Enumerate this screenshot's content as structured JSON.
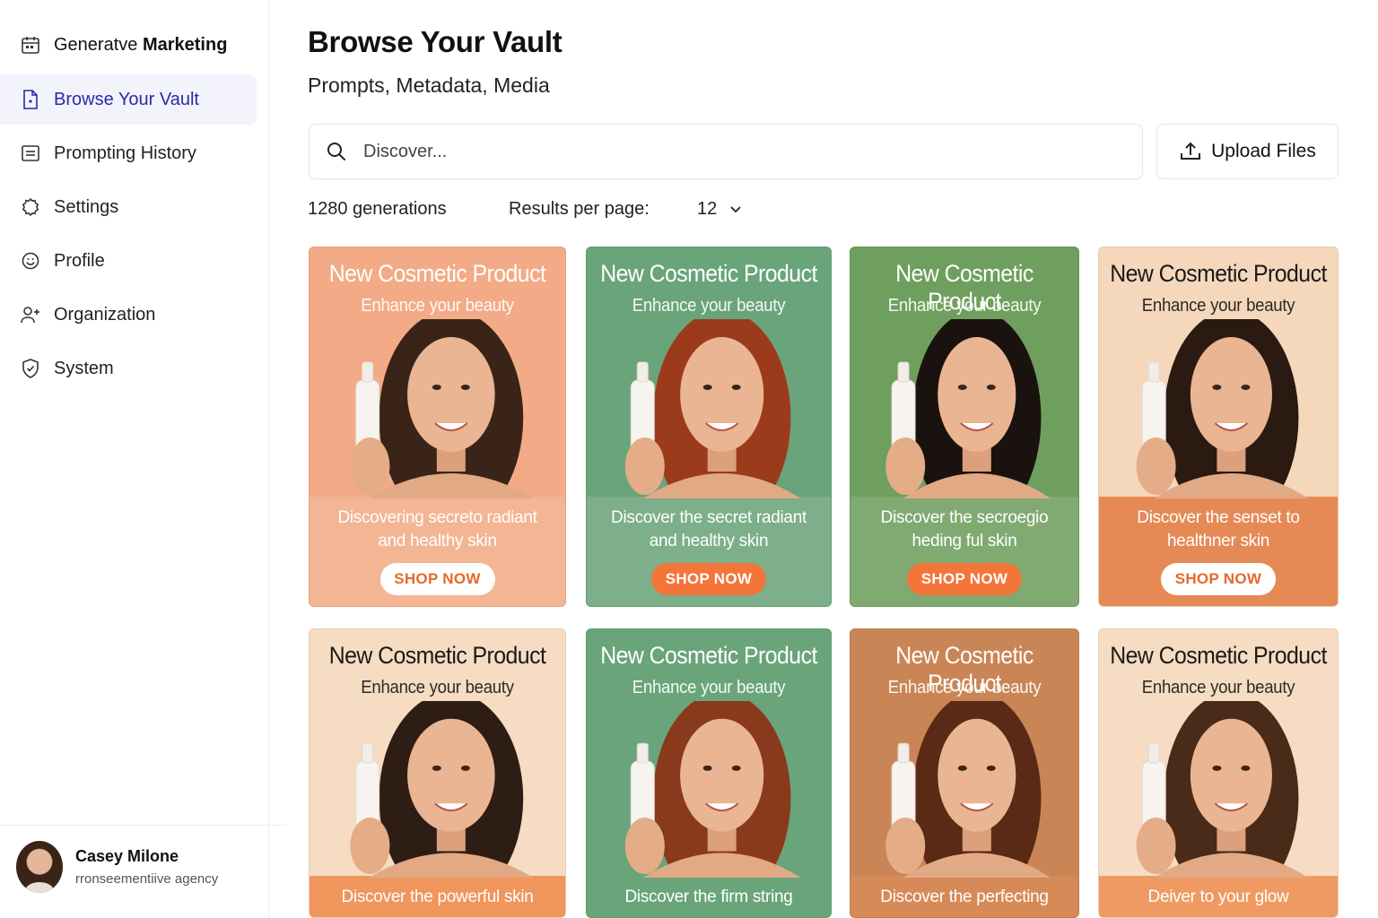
{
  "sidebar": {
    "brand": {
      "prefix": "Generatve",
      "strong": "Marketing",
      "icon": "calendar-icon"
    },
    "items": [
      {
        "label": "Browse Your Vault",
        "icon": "file-icon",
        "active": true
      },
      {
        "label": "Prompting History",
        "icon": "list-icon",
        "active": false
      },
      {
        "label": "Settings",
        "icon": "gear-icon",
        "active": false
      },
      {
        "label": "Profile",
        "icon": "smile-icon",
        "active": false
      },
      {
        "label": "Organization",
        "icon": "users-icon",
        "active": false
      },
      {
        "label": "System",
        "icon": "shield-icon",
        "active": false
      }
    ],
    "user": {
      "name": "Casey Milone",
      "org": "rronseementiive agency"
    }
  },
  "main": {
    "title": "Browse Your Vault",
    "subtitle": "Prompts, Metadata, Media",
    "search": {
      "placeholder": "Discover..."
    },
    "upload_label": "Upload Files",
    "count_label": "1280 generations",
    "results_per_page_label": "Results per page:",
    "results_per_page_value": "12"
  },
  "cards": [
    {
      "title": "New Cosmetic Product",
      "subtitle": "Enhance your beauty",
      "desc_line1": "Discovering secreto radiant",
      "desc_line2": "and healthy skin",
      "cta": "SHOP NOW",
      "bg": "#f2ab86",
      "text": "#ffffff",
      "cta_bg": "#ffffff",
      "cta_text": "#e46a2c",
      "hair": "#3a2418"
    },
    {
      "title": "New Cosmetic Product",
      "subtitle": "Enhance your beauty",
      "desc_line1": "Discover the secret radiant",
      "desc_line2": "and healthy skin",
      "cta": "SHOP NOW",
      "bg": "#6aa47a",
      "text": "#ffffff",
      "cta_bg": "#f4753a",
      "cta_text": "#ffffff",
      "hair": "#9c3b1c"
    },
    {
      "title": "New Cosmetic Product",
      "subtitle": "Enhance your beauty",
      "desc_line1": "Discover the secroegio",
      "desc_line2": "heding ful skin",
      "cta": "SHOP NOW",
      "bg": "#6f9f5e",
      "text": "#ffffff",
      "cta_bg": "#f4753a",
      "cta_text": "#ffffff",
      "hair": "#1a120e"
    },
    {
      "title": "New Cosmetic Product",
      "subtitle": "Enhance your beauty",
      "desc_line1": "Discover the senset to",
      "desc_line2": "healthner skin",
      "cta": "SHOP NOW",
      "bg": "#f5d8bc",
      "band": "#e58a55",
      "text": "#1a1a1a",
      "band_text": "#ffffff",
      "cta_bg": "#ffffff",
      "cta_text": "#e46a2c",
      "hair": "#2a1a12"
    },
    {
      "title": "New Cosmetic Product",
      "subtitle": "Enhance your beauty",
      "desc_line1": "Discover the powerful skin",
      "desc_line2": "",
      "cta": "",
      "bg": "#f6dcc2",
      "band": "#f0955c",
      "text": "#1a1a1a",
      "band_text": "#ffffff",
      "hair": "#2e1d14"
    },
    {
      "title": "New Cosmetic Product",
      "subtitle": "Enhance your beauty",
      "desc_line1": "Discover the firm string",
      "desc_line2": "",
      "cta": "",
      "bg": "#6aa47a",
      "band": "#6aa47a",
      "text": "#ffffff",
      "band_text": "#ffffff",
      "hair": "#8a3a1c"
    },
    {
      "title": "New Cosmetic Product",
      "subtitle": "Enhance your beauty",
      "desc_line1": "Discover the perfecting",
      "desc_line2": "",
      "cta": "",
      "bg": "#c98555",
      "band": "#d68a58",
      "text": "#ffffff",
      "band_text": "#ffffff",
      "hair": "#5a2a16"
    },
    {
      "title": "New Cosmetic Product",
      "subtitle": "Enhance your beauty",
      "desc_line1": "Deiver to your glow",
      "desc_line2": "",
      "cta": "",
      "bg": "#f6dcc2",
      "band": "#ef9a62",
      "text": "#1a1a1a",
      "band_text": "#ffffff",
      "hair": "#4a2a18"
    }
  ]
}
